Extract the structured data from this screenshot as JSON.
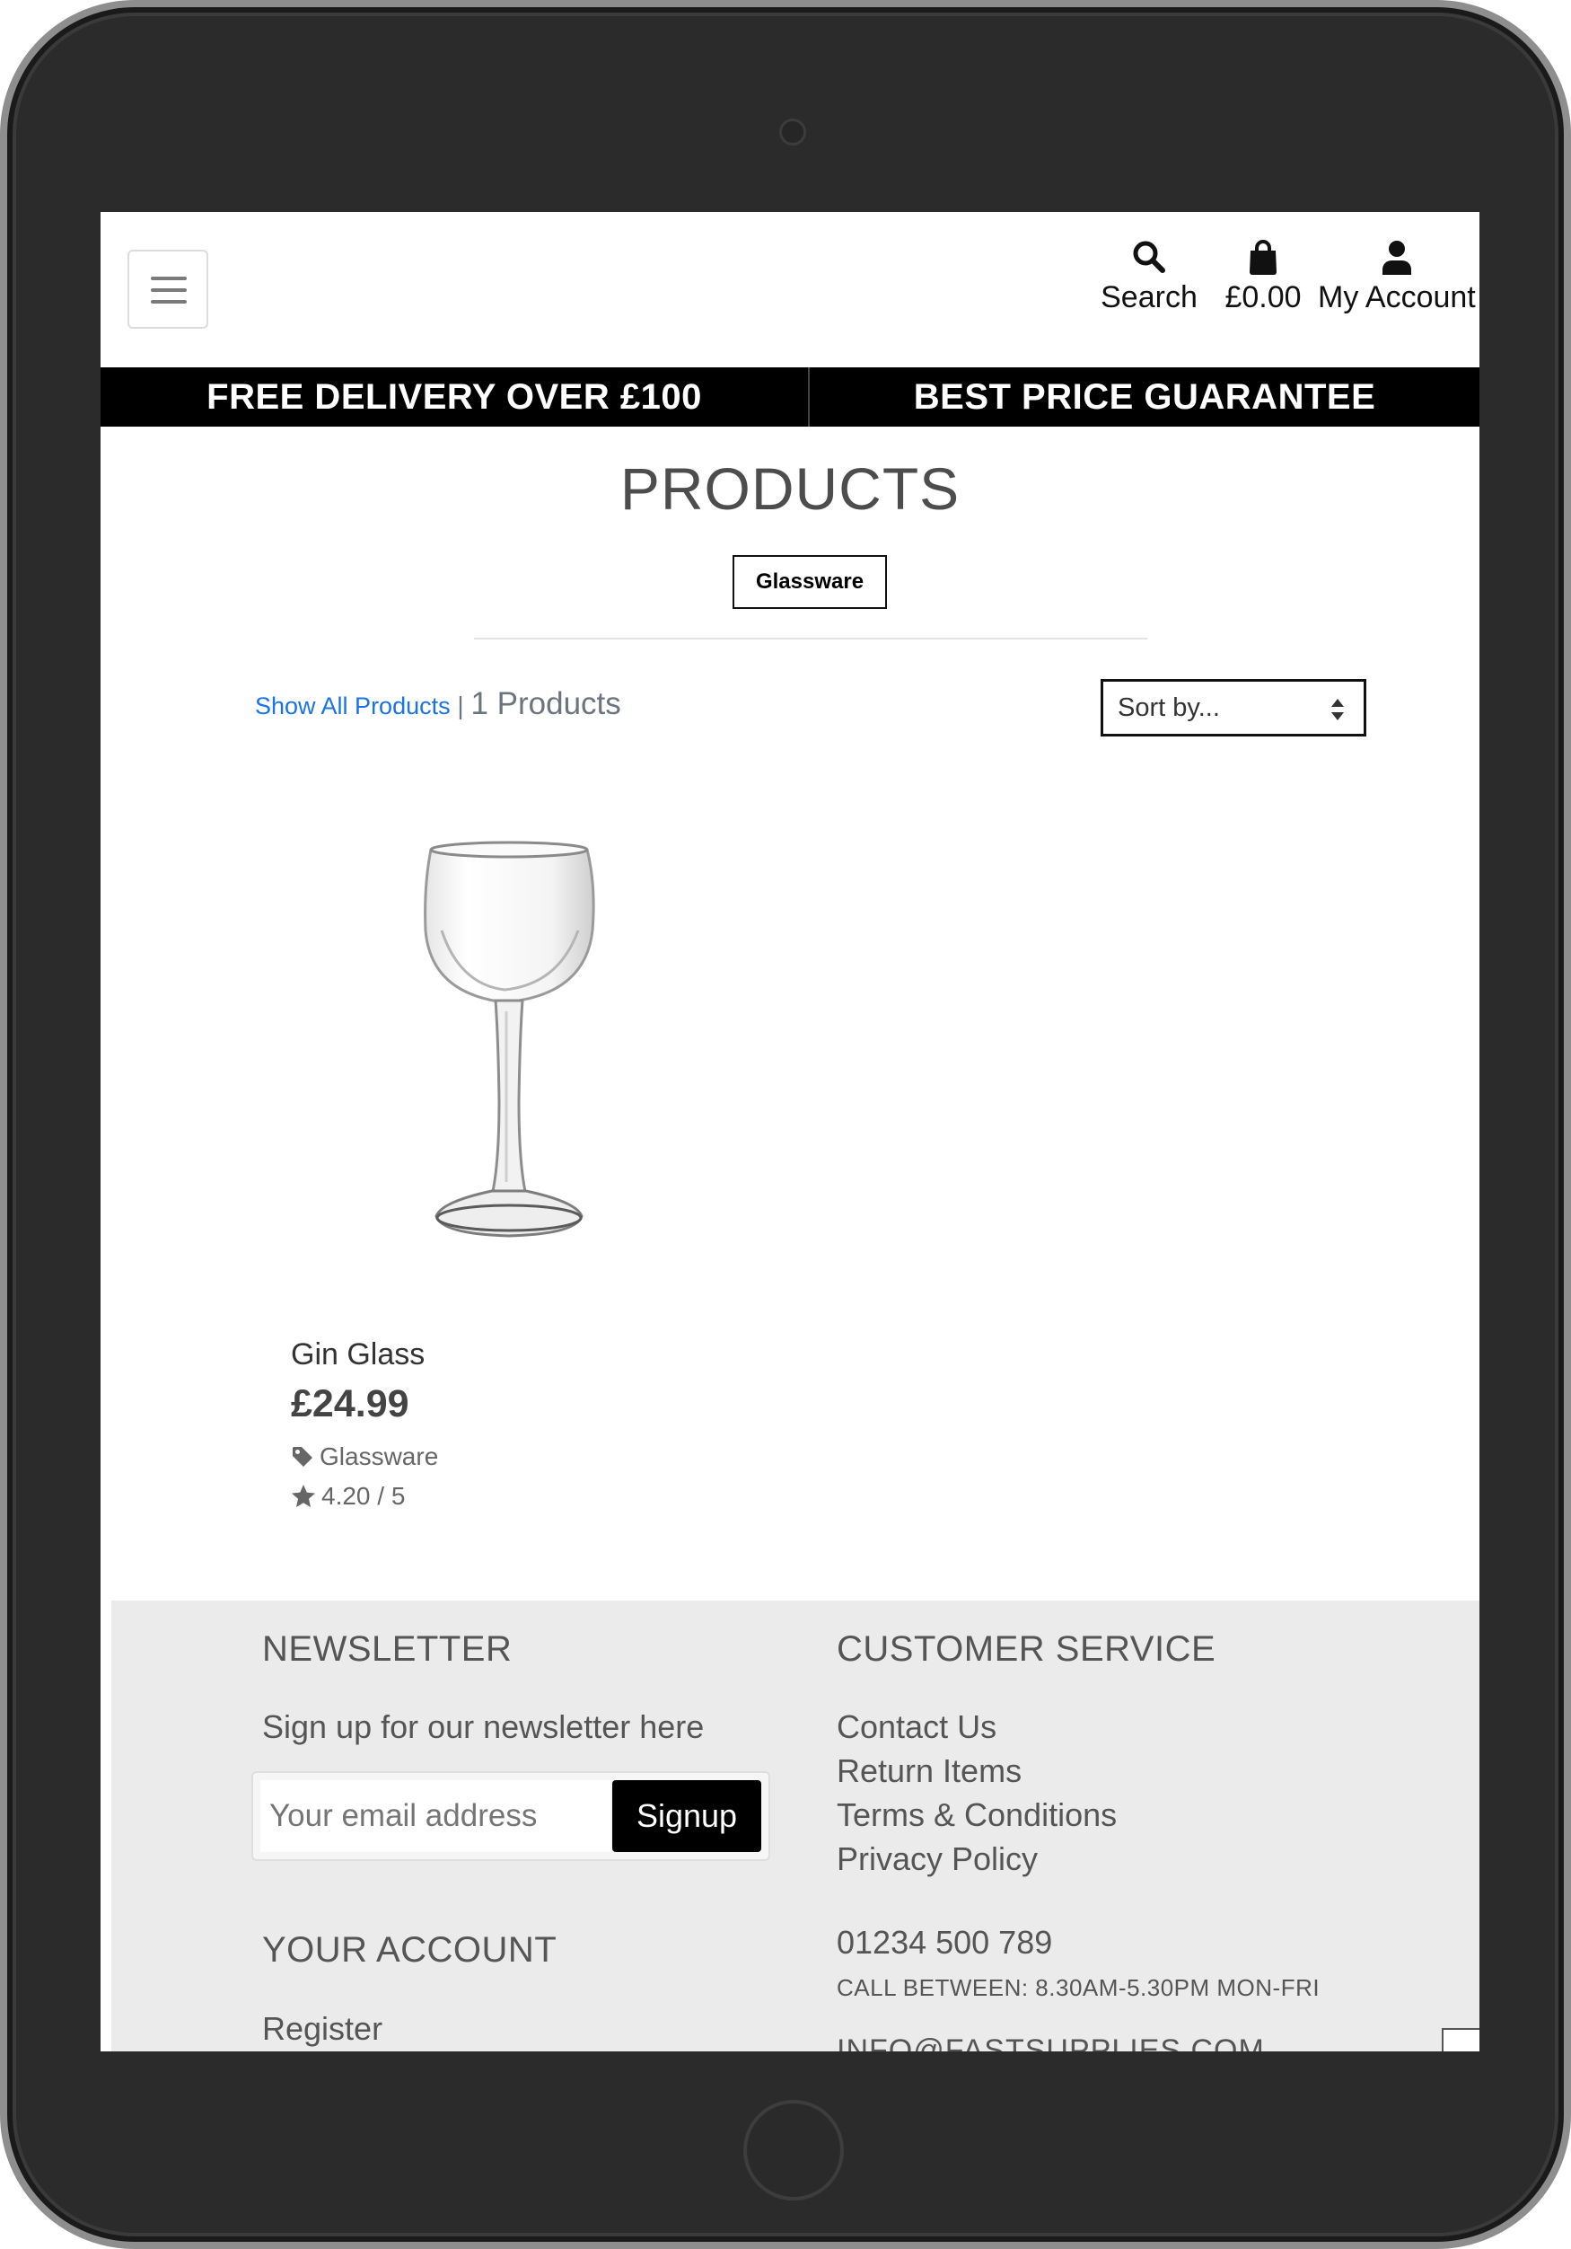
{
  "header": {
    "search_label": "Search",
    "bag_label": "£0.00",
    "account_label": "My Account"
  },
  "banner": {
    "left": "FREE DELIVERY OVER £100",
    "right": "BEST PRICE GUARANTEE"
  },
  "main": {
    "title": "PRODUCTS",
    "category_badge": "Glassware",
    "show_all": "Show All Products",
    "separator": " | ",
    "count": "1 Products",
    "sort_placeholder": "Sort by..."
  },
  "products": [
    {
      "name": "Gin Glass",
      "price": "£24.99",
      "category": "Glassware",
      "rating": "4.20 / 5"
    }
  ],
  "footer": {
    "newsletter": {
      "heading": "NEWSLETTER",
      "text": "Sign up for our newsletter here",
      "email_placeholder": "Your email address",
      "signup": "Signup"
    },
    "account": {
      "heading": "YOUR ACCOUNT",
      "links": [
        "Register"
      ]
    },
    "customer_service": {
      "heading": "CUSTOMER SERVICE",
      "links": [
        "Contact Us",
        "Return Items",
        "Terms & Conditions",
        "Privacy Policy"
      ],
      "phone": "01234 500 789",
      "hours": "CALL BETWEEN: 8.30AM-5.30PM MON-FRI",
      "email": "INFO@FASTSUPPLIES.COM"
    }
  },
  "colors": {
    "banner_bg": "#000000",
    "footer_bg": "#ebebeb",
    "link": "#1a73e8",
    "frame": "#2b2b2b"
  },
  "icons": {
    "search": "search-icon",
    "bag": "shopping-bag-icon",
    "account": "user-icon",
    "menu": "hamburger-menu-icon",
    "tag": "tag-icon",
    "star": "star-icon"
  }
}
